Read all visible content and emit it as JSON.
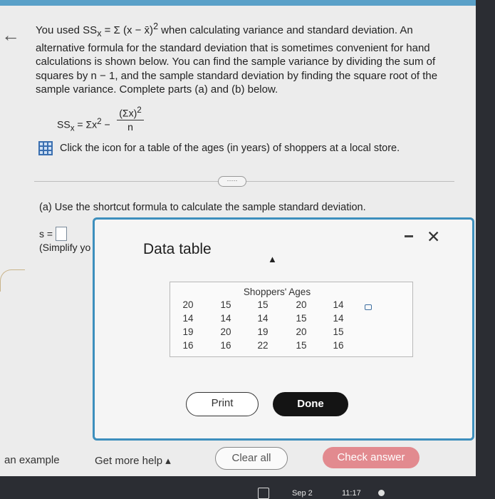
{
  "intro": {
    "line1": "You used SS",
    "line1_sub": "x",
    "line1_mid": " = Σ (x − x̄)",
    "line1_sup": "2",
    "line1_end": " when calculating variance and standard deviation. An",
    "rest": "alternative formula for the standard deviation that is sometimes convenient for hand calculations is shown below. You can find the sample variance by dividing the sum of squares by n − 1, and the sample standard deviation by finding the square root of the sample variance. Complete parts (a) and (b) below."
  },
  "formula": {
    "lhs": "SS",
    "lhs_sub": "x",
    "lhs_rest": " = Σx",
    "lhs_sup": "2",
    "minus": " −",
    "numerator": "(Σx)",
    "numerator_sup": "2",
    "denominator": "n"
  },
  "table_link": "Click the icon for a table of the ages (in years) of shoppers at a local store.",
  "more_pill": "·····",
  "part_a": "(a) Use the shortcut formula to calculate the sample standard deviation.",
  "s_label": "s =",
  "simplify_text": "(Simplify yo",
  "modal": {
    "title": "Data table",
    "close_glyph": "✕",
    "table_caption": "Shoppers' Ages",
    "rows": [
      [
        "20",
        "15",
        "15",
        "20",
        "14"
      ],
      [
        "14",
        "14",
        "14",
        "15",
        "14"
      ],
      [
        "19",
        "20",
        "19",
        "20",
        "15"
      ],
      [
        "16",
        "16",
        "22",
        "15",
        "16"
      ]
    ],
    "print_label": "Print",
    "done_label": "Done"
  },
  "footer": {
    "example": "an example",
    "help": "Get more help ▴",
    "clear": "Clear all",
    "check": "Check answer"
  },
  "taskbar": {
    "date": "Sep 2",
    "time": "11:17"
  },
  "colors": {
    "modal_border": "#3d8fbd",
    "done_bg": "#141414",
    "check_bg": "#e28a8f",
    "icon_blue": "#3a6fb0"
  }
}
